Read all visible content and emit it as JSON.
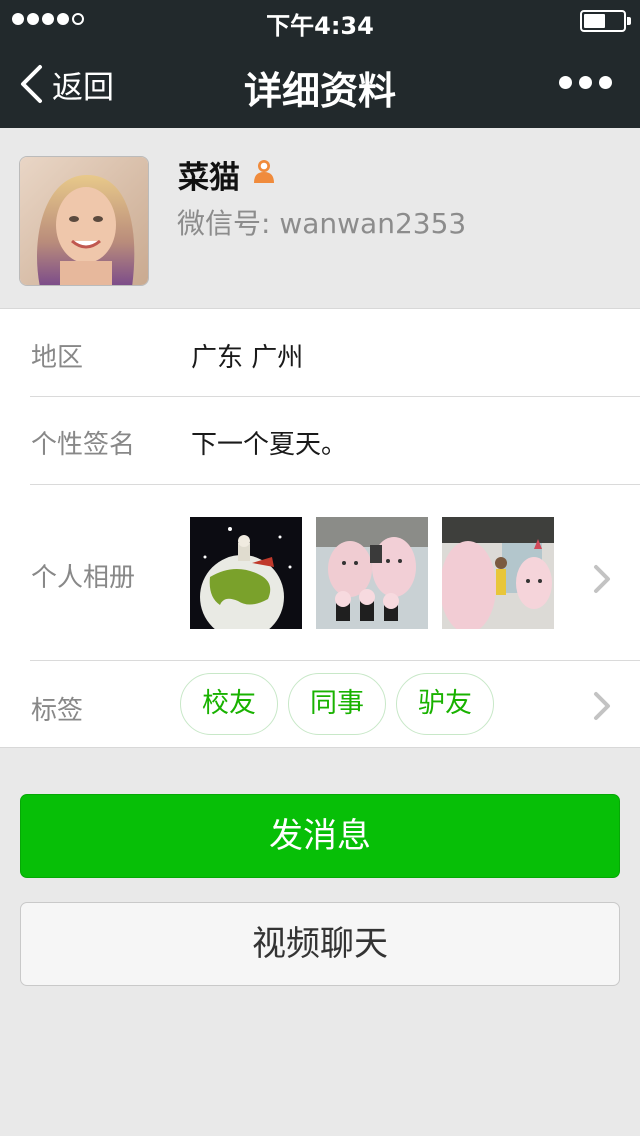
{
  "status_bar": {
    "time": "下午4:34",
    "signal_bars": 4,
    "signal_total": 5,
    "battery_level": 0.55
  },
  "nav": {
    "back_label": "返回",
    "title": "详细资料",
    "more_icon": "more-dots-icon"
  },
  "profile": {
    "name": "菜猫",
    "gender_icon": "female-person-icon",
    "wechat_id": "微信号: wanwan2353"
  },
  "details": {
    "region_label": "地区",
    "region_value": "广东 广州",
    "signature_label": "个性签名",
    "signature_value": "下一个夏天。",
    "album_label": "个人相册",
    "tags_label": "标签",
    "tags": [
      "校友",
      "同事",
      "驴友"
    ]
  },
  "actions": {
    "send_message": "发消息",
    "video_chat": "视频聊天"
  },
  "colors": {
    "nav_bg": "#22292c",
    "accent_green": "#07bf07",
    "tag_green": "#19b200",
    "page_bg": "#e9e9e9"
  }
}
